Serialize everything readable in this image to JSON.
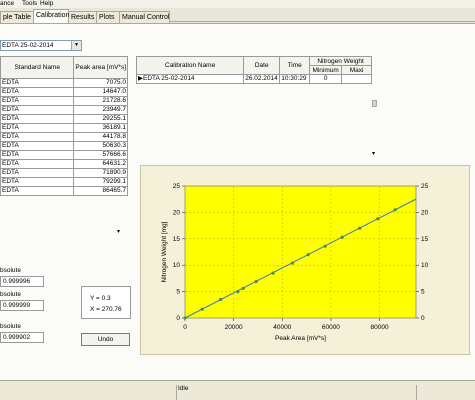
{
  "menu": [
    "ance",
    "Tools",
    "Help"
  ],
  "tabs": [
    "ple Table",
    "Calibration",
    "Results",
    "Plots",
    "Manual Control"
  ],
  "active_tab": "Calibration",
  "calibration_select": {
    "value": "EDTA 25-02-2014"
  },
  "standards_table": {
    "headers": [
      "Standard Name",
      "Peak area [mV*s]"
    ],
    "rows": [
      [
        "EDTA",
        "7075.0"
      ],
      [
        "EDTA",
        "14647.0"
      ],
      [
        "EDTA",
        "21728.6"
      ],
      [
        "EDTA",
        "23949.7"
      ],
      [
        "EDTA",
        "29255.1"
      ],
      [
        "EDTA",
        "36189.1"
      ],
      [
        "EDTA",
        "44178.8"
      ],
      [
        "EDTA",
        "50630.3"
      ],
      [
        "EDTA",
        "57666.6"
      ],
      [
        "EDTA",
        "64631.2"
      ],
      [
        "EDTA",
        "71890.9"
      ],
      [
        "EDTA",
        "79299.1"
      ],
      [
        "EDTA",
        "86465.7"
      ]
    ]
  },
  "fit_stats": [
    {
      "label": "bsolute",
      "value": "0.999996"
    },
    {
      "label": "bsolute",
      "value": "0.999999"
    },
    {
      "label": "bsolute",
      "value": "0.999902"
    }
  ],
  "xy_readout": {
    "y": "Y = 0.3",
    "x": "X = 270.76"
  },
  "undo_label": "Undo",
  "calibrations_table": {
    "headers": [
      "Calibration Name",
      "Date",
      "Time",
      "Nitrogen Weight"
    ],
    "sub_headers": [
      "Minimum",
      "Maxi"
    ],
    "rows": [
      {
        "name": "EDTA 25-02-2014",
        "date": "26.02.2014",
        "time": "10:30:29",
        "min": "0",
        "max": ""
      }
    ]
  },
  "status": {
    "text": "Idle"
  },
  "chart_data": {
    "type": "scatter",
    "xlabel": "Peak Area [mV*s]",
    "ylabel": "Nitrogen Weight [mg]",
    "xlim": [
      0,
      95000
    ],
    "ylim": [
      0,
      25
    ],
    "x_ticks": [
      0,
      20000,
      40000,
      60000,
      80000
    ],
    "y_ticks": [
      0,
      5,
      10,
      15,
      20,
      25
    ],
    "points": [
      {
        "x": 0,
        "y": 0
      },
      {
        "x": 7075.0,
        "y": 1.67
      },
      {
        "x": 14647.0,
        "y": 3.5
      },
      {
        "x": 21728.6,
        "y": 5.0
      },
      {
        "x": 23949.7,
        "y": 5.6
      },
      {
        "x": 29255.1,
        "y": 6.9
      },
      {
        "x": 36189.1,
        "y": 8.5
      },
      {
        "x": 44178.8,
        "y": 10.4
      },
      {
        "x": 50630.3,
        "y": 12.0
      },
      {
        "x": 57666.6,
        "y": 13.6
      },
      {
        "x": 64631.2,
        "y": 15.3
      },
      {
        "x": 71890.9,
        "y": 17.0
      },
      {
        "x": 79299.1,
        "y": 18.8
      },
      {
        "x": 86465.7,
        "y": 20.5
      }
    ],
    "fit_line": {
      "slope": 0.000237,
      "intercept": 0
    },
    "colors": {
      "plot_bg": "#ffff00",
      "line": "#2f7fbf",
      "marker": "#4f8f3f",
      "panel_bg": "#f5f1d8"
    },
    "grid": true
  }
}
